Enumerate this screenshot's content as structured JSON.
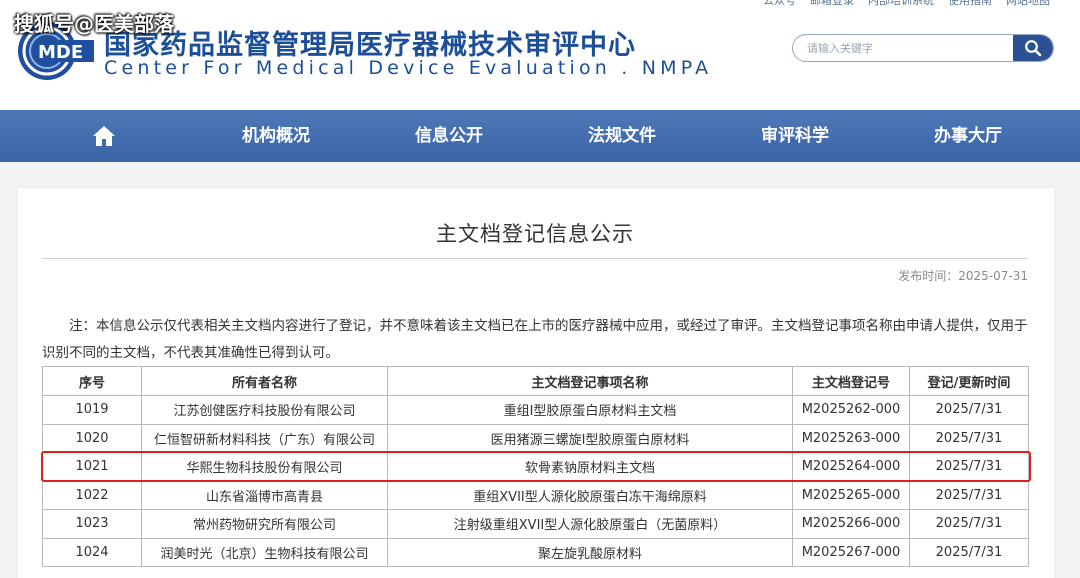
{
  "watermark": "搜狐号@医美部落",
  "top_links": [
    "公众号",
    "邮箱登录",
    "内部培训系统",
    "使用指南",
    "网站地图"
  ],
  "logo": {
    "text": "MDE"
  },
  "site": {
    "title_cn": "国家药品监督管理局医疗器械技术审评中心",
    "title_en": "Center For Medical Device Evaluation . NMPA"
  },
  "search": {
    "placeholder": "请输入关键字",
    "icon": "search-icon"
  },
  "nav": {
    "home_icon": "home-icon",
    "items": [
      "机构概况",
      "信息公开",
      "法规文件",
      "审评科学",
      "办事大厅"
    ]
  },
  "article": {
    "title": "主文档登记信息公示",
    "publish_date": "发布时间：2025-07-31",
    "note": "注：本信息公示仅代表相关主文档内容进行了登记，并不意味着该主文档已在上市的医疗器械中应用，或经过了审评。主文档登记事项名称由申请人提供，仅用于识别不同的主文档，不代表其准确性已得到认可。"
  },
  "table": {
    "headers": [
      "序号",
      "所有者名称",
      "主文档登记事项名称",
      "主文档登记号",
      "登记/更新时间"
    ],
    "rows": [
      [
        "1019",
        "江苏创健医疗科技股份有限公司",
        "重组Ⅰ型胶原蛋白原材料主文档",
        "M2025262-000",
        "2025/7/31"
      ],
      [
        "1020",
        "仁恒智研新材料科技（广东）有限公司",
        "医用猪源三螺旋Ⅰ型胶原蛋白原材料",
        "M2025263-000",
        "2025/7/31"
      ],
      [
        "1021",
        "华熙生物科技股份有限公司",
        "软骨素钠原材料主文档",
        "M2025264-000",
        "2025/7/31"
      ],
      [
        "1022",
        "山东省淄博市高青县",
        "重组XVII型人源化胶原蛋白冻干海绵原料",
        "M2025265-000",
        "2025/7/31"
      ],
      [
        "1023",
        "常州药物研究所有限公司",
        "注射级重组XVII型人源化胶原蛋白（无菌原料）",
        "M2025266-000",
        "2025/7/31"
      ],
      [
        "1024",
        "润美时光（北京）生物科技有限公司",
        "聚左旋乳酸原材料",
        "M2025267-000",
        "2025/7/31"
      ]
    ],
    "highlighted_row": "1021",
    "highlight_color": "#e02020"
  },
  "colors": {
    "brand": "#1d4f98",
    "nav": "#3a64a6",
    "search_button": "#2c5192"
  }
}
